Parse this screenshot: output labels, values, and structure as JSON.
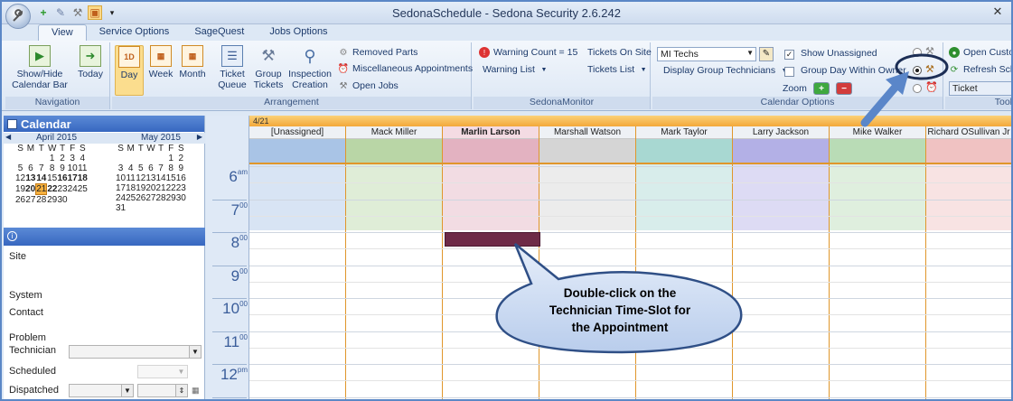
{
  "window": {
    "title": "SedonaSchedule - Sedona Security 2.6.242",
    "close": "✕"
  },
  "qat": {
    "app_icon": "wrench-icon",
    "items": [
      "+",
      "✎",
      "⚒",
      "▣",
      "▾"
    ]
  },
  "tabs": [
    "View",
    "Service Options",
    "SageQuest",
    "Jobs Options"
  ],
  "ribbon": {
    "navigation": {
      "label": "Navigation",
      "show_hide_line1": "Show/Hide",
      "show_hide_line2": "Calendar Bar",
      "today": "Today"
    },
    "arrangement": {
      "label": "Arrangement",
      "day": "Day",
      "week": "Week",
      "month": "Month",
      "ticket_queue_1": "Ticket",
      "ticket_queue_2": "Queue",
      "group_tickets_1": "Group",
      "group_tickets_2": "Tickets",
      "inspection_1": "Inspection",
      "inspection_2": "Creation",
      "removed_parts": "Removed Parts",
      "misc_appointments": "Miscellaneous Appointments",
      "open_jobs": "Open Jobs"
    },
    "monitor": {
      "label": "SedonaMonitor",
      "warning_count": "Warning Count = 15",
      "warning_list": "Warning List",
      "tickets_on_site": "Tickets On Site",
      "tickets_list": "Tickets List"
    },
    "calendar_options": {
      "label": "Calendar Options",
      "group_select": "MI Techs",
      "display_group": "Display Group Technicians",
      "show_unassigned": "Show Unassigned",
      "group_day": "Group Day Within Owner",
      "zoom": "Zoom"
    },
    "tools": {
      "label": "Tool",
      "open_custom": "Open Custo",
      "refresh_sched": "Refresh Sch",
      "ticket_field": "Ticket"
    }
  },
  "calendar_panel": {
    "title": "Calendar",
    "april": {
      "name": "April 2015",
      "days": [
        "S",
        "M",
        "T",
        "W",
        "T",
        "F",
        "S"
      ],
      "weeks": [
        [
          "",
          "",
          "",
          "1",
          "2",
          "3",
          "4"
        ],
        [
          "5",
          "6",
          "7",
          "8",
          "9",
          "10",
          "11"
        ],
        [
          "12",
          "13",
          "14",
          "15",
          "16",
          "17",
          "18"
        ],
        [
          "19",
          "20",
          "21",
          "22",
          "23",
          "24",
          "25"
        ],
        [
          "26",
          "27",
          "28",
          "29",
          "30",
          "",
          ""
        ]
      ]
    },
    "may": {
      "name": "May 2015",
      "days": [
        "S",
        "M",
        "T",
        "W",
        "T",
        "F",
        "S"
      ],
      "weeks": [
        [
          "",
          "",
          "",
          "",
          "",
          "1",
          "2"
        ],
        [
          "3",
          "4",
          "5",
          "6",
          "7",
          "8",
          "9"
        ],
        [
          "10",
          "11",
          "12",
          "13",
          "14",
          "15",
          "16"
        ],
        [
          "17",
          "18",
          "19",
          "20",
          "21",
          "22",
          "23"
        ],
        [
          "24",
          "25",
          "26",
          "27",
          "28",
          "29",
          "30"
        ],
        [
          "31",
          "",
          "",
          "",
          "",
          "",
          ""
        ]
      ]
    }
  },
  "details": {
    "site": "Site",
    "system": "System",
    "contact": "Contact",
    "problem": "Problem",
    "technician": "Technician",
    "scheduled": "Scheduled",
    "dispatched": "Dispatched"
  },
  "schedule": {
    "date": "4/21",
    "technicians": [
      "[Unassigned]",
      "Mack Miller",
      "Marlin Larson",
      "Marshall Watson",
      "Mark Taylor",
      "Larry Jackson",
      "Mike Walker",
      "Richard OSullivan Jr"
    ],
    "times": [
      {
        "h": "6",
        "m": "am"
      },
      {
        "h": "7",
        "m": "00"
      },
      {
        "h": "8",
        "m": "00"
      },
      {
        "h": "9",
        "m": "00"
      },
      {
        "h": "10",
        "m": "00"
      },
      {
        "h": "11",
        "m": "00"
      },
      {
        "h": "12",
        "m": "pm"
      }
    ]
  },
  "callout": {
    "line1": "Double-click on the",
    "line2": "Technician Time-Slot for",
    "line3": "the Appointment"
  },
  "colors": {
    "unassigned": "#a9c4e6",
    "mack": "#b9d6a6",
    "marlin": "#e3b2c1",
    "marshall": "#d5d5d5",
    "mark": "#a8d8d2",
    "larry": "#b3b0e6",
    "mike": "#b9dcb6",
    "richard": "#f0c2c2"
  }
}
